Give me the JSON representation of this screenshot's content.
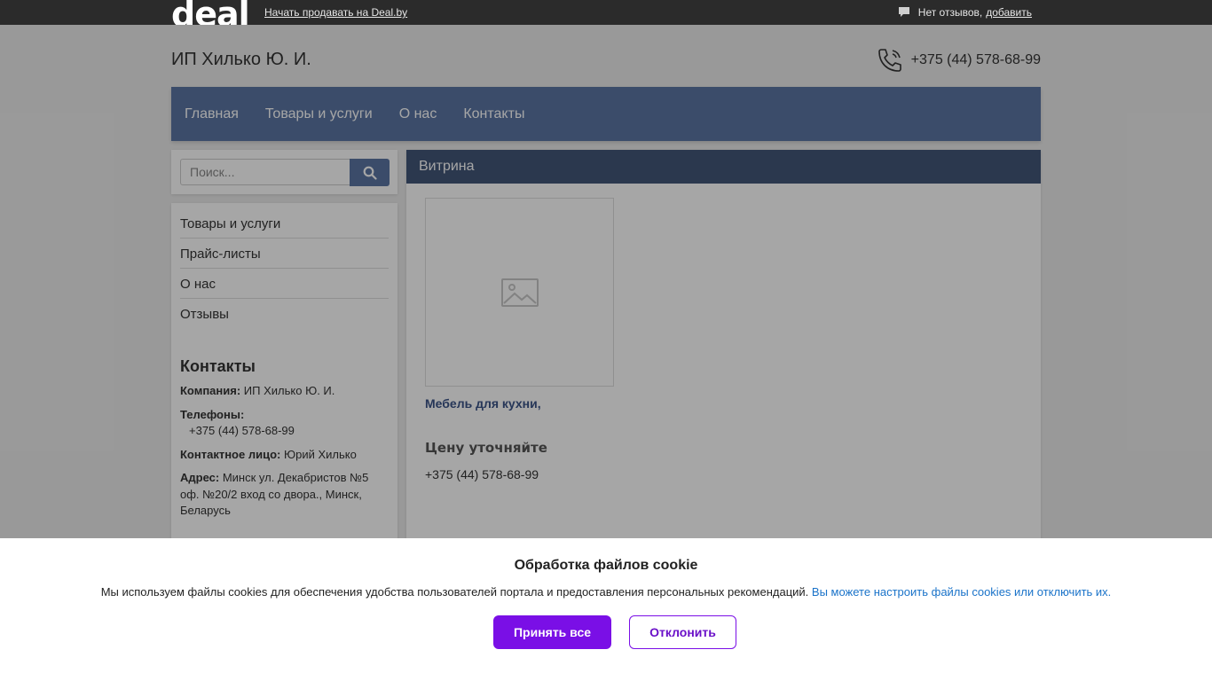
{
  "topbar": {
    "logo": "deal",
    "sell_link": "Начать продавать на Deal.by",
    "reviews_text": "Нет отзывов,",
    "reviews_add": "добавить"
  },
  "header": {
    "company": "ИП Хилько Ю. И.",
    "phone": "+375 (44) 578-68-99"
  },
  "nav": {
    "items": [
      "Главная",
      "Товары и услуги",
      "О нас",
      "Контакты"
    ]
  },
  "search": {
    "placeholder": "Поиск..."
  },
  "sidebar": {
    "menu": [
      "Товары и услуги",
      "Прайс-листы",
      "О нас",
      "Отзывы"
    ],
    "contacts_heading": "Контакты",
    "company_label": "Компания:",
    "company_value": "ИП Хилько Ю. И.",
    "phones_label": "Телефоны:",
    "phones_value": "+375 (44) 578-68-99",
    "contact_person_label": "Контактное лицо:",
    "contact_person_value": "Юрий Хилько",
    "address_label": "Адрес:",
    "address_value": "Минск ул. Декабристов №5 оф. №20/2 вход со двора., Минск, Беларусь"
  },
  "main": {
    "header": "Витрина",
    "product": {
      "name": "Мебель для кухни,",
      "price": "Цену уточняйте",
      "phone": "+375 (44) 578-68-99"
    }
  },
  "cookie": {
    "title": "Обработка файлов cookie",
    "text": "Мы используем файлы cookies для обеспечения удобства пользователей портала и предоставления персональных рекомендаций.",
    "link": "Вы можете настроить файлы cookies или отключить их.",
    "accept": "Принять все",
    "decline": "Отклонить"
  },
  "colors": {
    "nav": "#5b76a4",
    "main_header": "#425679",
    "accent": "#7a0fe6",
    "link": "#1a73c9"
  }
}
